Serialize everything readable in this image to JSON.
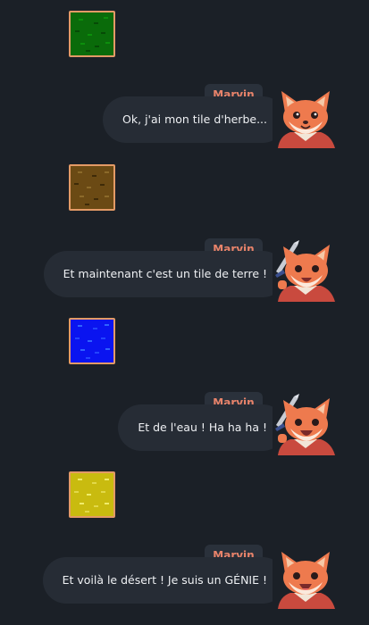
{
  "speaker": "Marvin",
  "messages": [
    {
      "tile": "grass",
      "text": "Ok, j'ai mon tile d'herbe..."
    },
    {
      "tile": "dirt",
      "text": "Et maintenant c'est un tile de terre !"
    },
    {
      "tile": "water",
      "text": "Et de l'eau ! Ha ha ha !"
    },
    {
      "tile": "sand",
      "text": "Et voilà le désert ! Je suis un GÉNIE !"
    }
  ],
  "tile_colors": {
    "grass": {
      "base": "#0a6b0a",
      "dots": [
        "#0c8f0c",
        "#064a06"
      ]
    },
    "dirt": {
      "base": "#6b4a14",
      "dots": [
        "#8c6a2a",
        "#3e2a08"
      ]
    },
    "water": {
      "base": "#0a14f0",
      "dots": [
        "#2f63ff",
        "#2345ff"
      ]
    },
    "sand": {
      "base": "#c9bb0f",
      "dots": [
        "#f0ec6a",
        "#e2d84a"
      ]
    }
  },
  "colors": {
    "background": "#1b2027",
    "bubble": "#262c35",
    "name_tag": "#2a313b",
    "name_text": "#e8836a",
    "tile_border": "#e39a66"
  },
  "icons": {
    "avatar": "fox-avatar-icon",
    "sword": "sword-icon"
  }
}
